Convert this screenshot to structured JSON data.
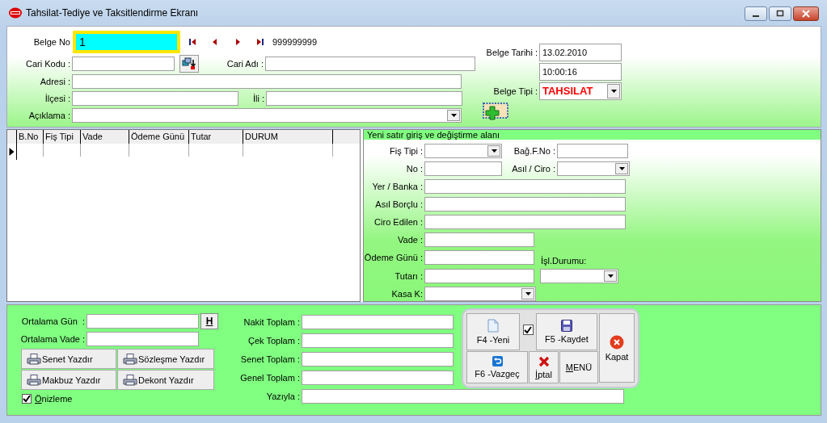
{
  "window": {
    "title": "Tahsilat-Tediye ve Taksitlendirme Ekranı"
  },
  "header": {
    "belge_no": {
      "label": "Belge No",
      "value": "1"
    },
    "last_number": "999999999",
    "cari_kodu": {
      "label": "Cari Kodu :"
    },
    "cari_adi": {
      "label": "Cari Adı :"
    },
    "adresi": {
      "label": "Adresi :"
    },
    "ilcesi": {
      "label": "İlçesi :"
    },
    "ili": {
      "label": "İli :"
    },
    "aciklama": {
      "label": "Açıklama :"
    },
    "belge_tarihi": {
      "label": "Belge Tarihi :",
      "value": "13.02.2010"
    },
    "saat": {
      "value": "10:00:16"
    },
    "belge_tipi": {
      "label": "Belge Tipi :",
      "value": "TAHSILAT"
    }
  },
  "grid": {
    "columns": [
      "B.No",
      "Fiş Tipi",
      "Vade",
      "Ödeme Günü",
      "Tutar",
      "DURUM"
    ]
  },
  "entry": {
    "legend": "Yeni satır giriş ve değiştirme alanı",
    "fis_tipi": {
      "label": "Fiş Tipi :"
    },
    "bag_f_no": {
      "label": "Bağ.F.No :"
    },
    "no": {
      "label": "No :"
    },
    "asil_ciro": {
      "label": "Asıl / Ciro :"
    },
    "yer_banka": {
      "label": "Yer / Banka :"
    },
    "asil_borclu": {
      "label": "Asıl Borçlu :"
    },
    "ciro_edilen": {
      "label": "Ciro Edilen :"
    },
    "vade": {
      "label": "Vade :"
    },
    "odeme_gunu": {
      "label": "Ödeme Günü :"
    },
    "isl_durumu": {
      "label": "İşl.Durumu:"
    },
    "tutari": {
      "label": "Tutarı :"
    },
    "kasa_k": {
      "label": "Kasa K:"
    }
  },
  "bottom": {
    "ortalama_gun": {
      "label": "Ortalama Gün  :"
    },
    "h_button": "H",
    "ortalama_vade": {
      "label": "Ortalama Vade :"
    },
    "print_buttons": [
      "Senet Yazdır",
      "Sözleşme Yazdır",
      "Makbuz Yazdır",
      "Dekont Yazdır"
    ],
    "preview": {
      "label": "Önizleme",
      "checked": true
    },
    "totals": [
      {
        "label": "Nakit Toplam :"
      },
      {
        "label": "Çek Toplam :"
      },
      {
        "label": "Senet Toplam :"
      },
      {
        "label": "Genel Toplam :"
      }
    ],
    "yaziyla": {
      "label": "Yazıyla :"
    }
  },
  "actions": {
    "new": "F4 -Yeni",
    "keep_open": {
      "checked": true
    },
    "save": "F5 -Kaydet",
    "close": "Kapat",
    "cancel": "F6 -Vazgeç",
    "delete": "İptal",
    "menu": "MENÜ"
  }
}
